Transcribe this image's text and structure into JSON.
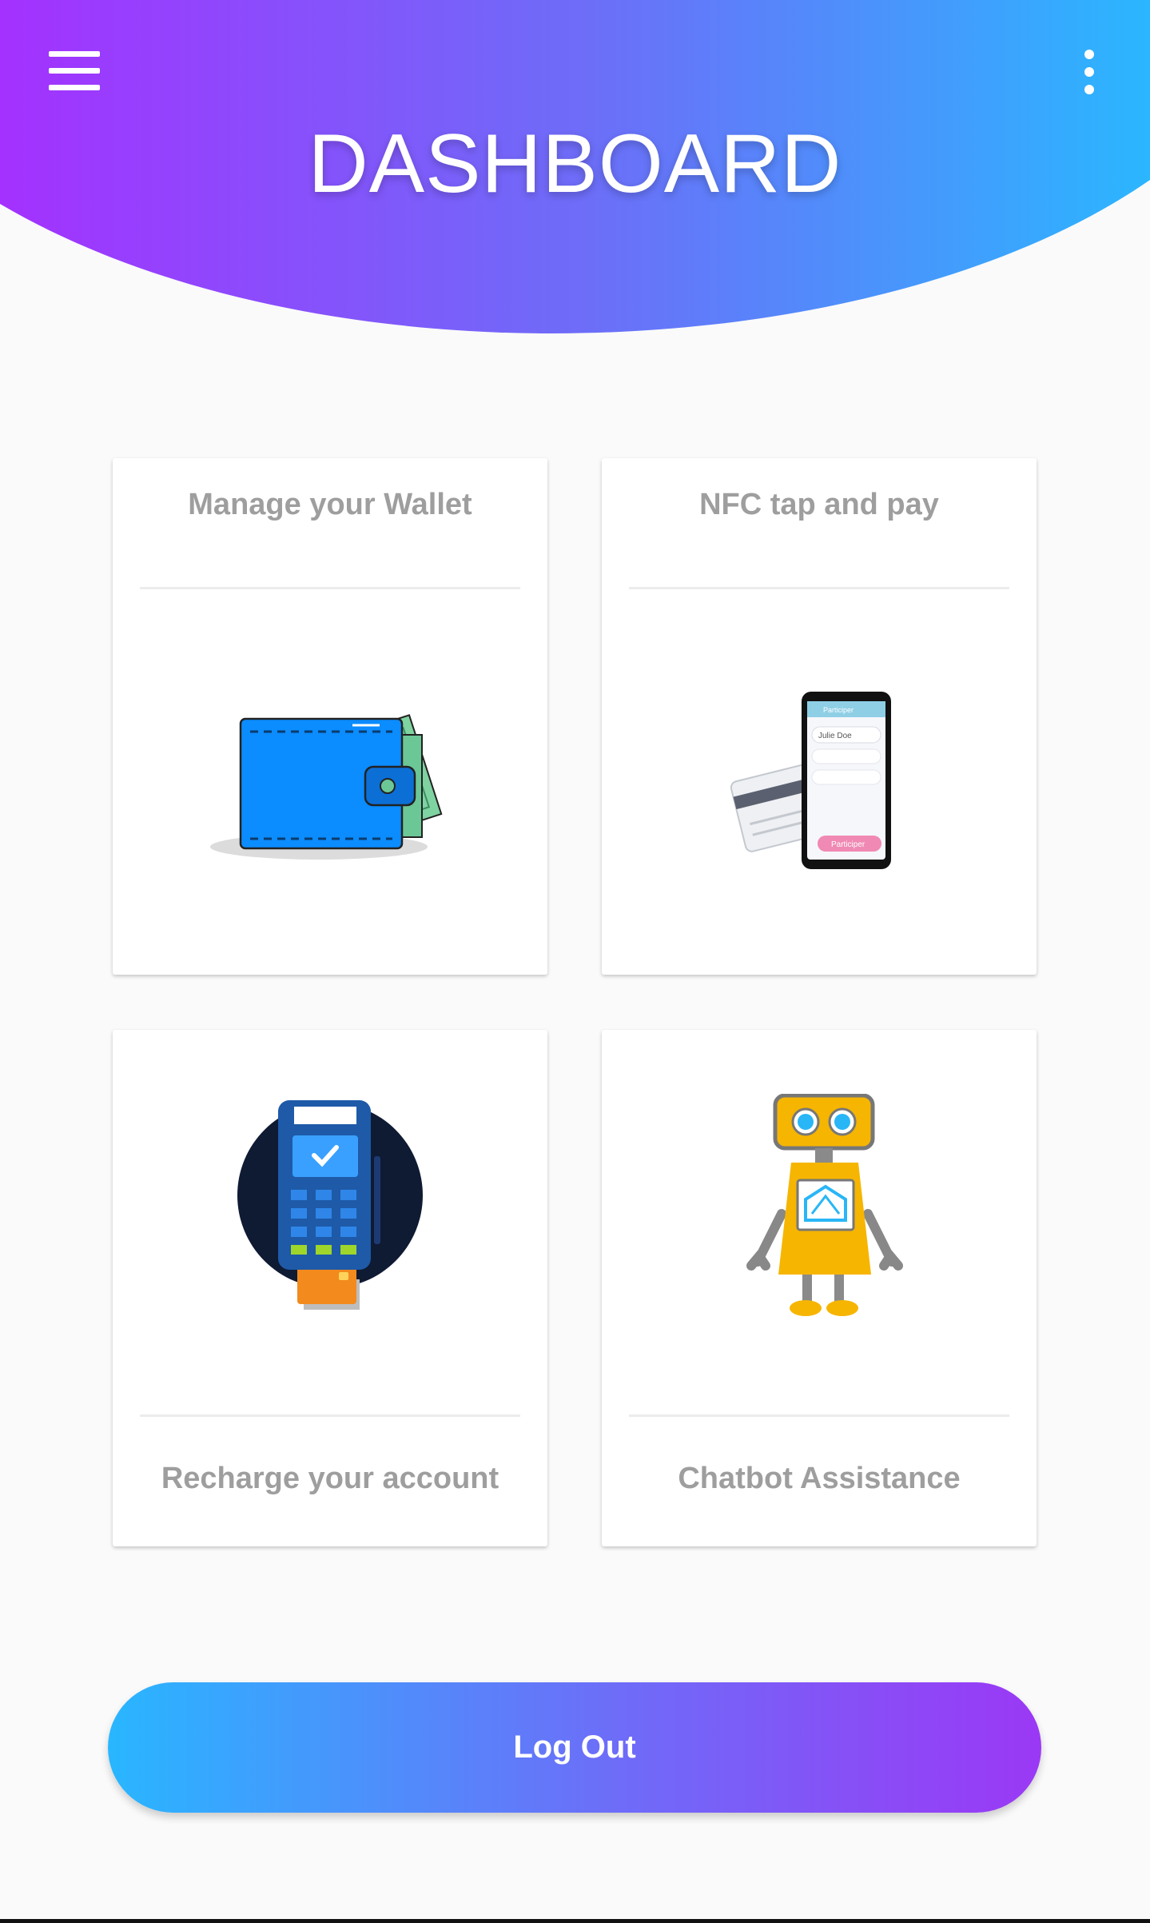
{
  "header": {
    "title": "DASHBOARD",
    "gradient": [
      "#a431ff",
      "#6e6cf8",
      "#2bb6ff"
    ],
    "menu_icon": "hamburger-menu-icon",
    "more_icon": "more-vertical-icon"
  },
  "cards": [
    {
      "label": "Manage your Wallet",
      "icon": "wallet-icon"
    },
    {
      "label": "NFC tap and pay",
      "icon": "phone-card-icon",
      "phone_screen": {
        "title": "Participer",
        "field_value": "Julie Doe",
        "button": "Participer"
      }
    },
    {
      "label": "Recharge your account",
      "icon": "payment-terminal-icon"
    },
    {
      "label": "Chatbot Assistance",
      "icon": "robot-icon"
    }
  ],
  "logout_label": "Log Out"
}
